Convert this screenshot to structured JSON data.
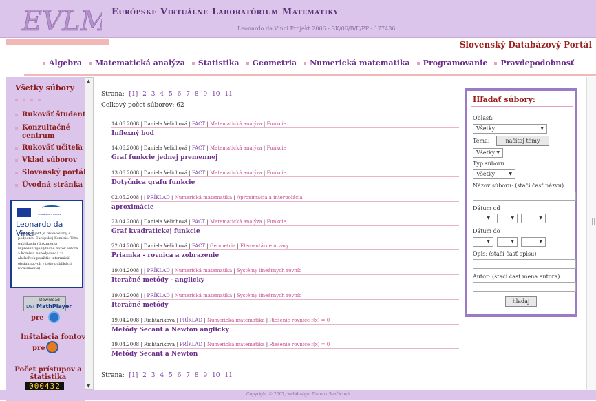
{
  "header": {
    "logo_text": "EVLM",
    "title": "Európske Virtuálne Laboratórium Matematiky",
    "subtitle": "Leonardo da Vinci Projekt 2006 - SK/06/B/F/PP - 177436",
    "portal_name": "Slovenský Databázový Portál"
  },
  "nav": {
    "items": [
      "Algebra",
      "Matematická analýza",
      "Štatistika",
      "Geometria",
      "Numerická matematika",
      "Programovanie",
      "Pravdepodobnosť"
    ]
  },
  "sidebar": {
    "title": "Všetky súbory",
    "items": [
      "Rukoväť študenta",
      "Konzultačné centrum",
      "Rukoväť učiteľa",
      "Vklad súborov",
      "Slovenský portál",
      "Úvodná stránka"
    ],
    "leonardo": {
      "small_text": "Vzdelávanie a kultúra",
      "name": "Leonardo da Vinci",
      "text": "Tento projekt je financovaný s podporou Európskej Komisie. Táto publikácia (dokument) reprezentuje výlučne názor autora a Komisia nezodpovedá za akékoľvek použitie informácií obsiahnutých v tejto publikácii (dokumente)."
    },
    "download_label": "Download",
    "mathplayer_label": "MathPlayer",
    "dsi_label": "DSI",
    "pre_label": "pre",
    "fonts_title": "Inštalácia fontov",
    "counter_title": "Počet prístupov a štatistika",
    "counter_value": "000432"
  },
  "content": {
    "pager_label": "Strana:",
    "pages": [
      "[1]",
      "2",
      "3",
      "4",
      "5",
      "6",
      "7",
      "8",
      "9",
      "10",
      "11"
    ],
    "total_label": "Celkový počet súborov: 62",
    "entries": [
      {
        "date": "14.06.2008",
        "author": "Daniela Velichová",
        "type": "FACT",
        "area": "Matematická analýza",
        "topic": "Funkcie",
        "name": "Inflexný bod"
      },
      {
        "date": "14.06.2008",
        "author": "Daniela Velichová",
        "type": "FACT",
        "area": "Matematická analýza",
        "topic": "Funkcie",
        "name": "Graf funkcie jednej premennej"
      },
      {
        "date": "13.06.2008",
        "author": "Daniela Velichová",
        "type": "FACT",
        "area": "Matematická analýza",
        "topic": "Funkcie",
        "name": "Dotyčnica grafu funkcie"
      },
      {
        "date": "02.05.2008",
        "author": "",
        "type": "PRÍKLAD",
        "area": "Numerická matematika",
        "topic": "Aproximácia a interpolácia",
        "name": "aproximácie"
      },
      {
        "date": "23.04.2008",
        "author": "Daniela Velichová",
        "type": "FACT",
        "area": "Matematická analýza",
        "topic": "Funkcie",
        "name": "Graf kvadratickej funkcie"
      },
      {
        "date": "22.04.2008",
        "author": "Daniela Velichová",
        "type": "FACT",
        "area": "Geometria",
        "topic": "Elementárne útvary",
        "name": "Priamka - rovnica a zobrazenie"
      },
      {
        "date": "19.04.2008",
        "author": "",
        "type": "PRÍKLAD",
        "area": "Numerická matematika",
        "topic": "Systémy lineárnych rovníc",
        "name": "Iteračné metódy - anglicky"
      },
      {
        "date": "19.04.2008",
        "author": "",
        "type": "PRÍKLAD",
        "area": "Numerická matematika",
        "topic": "Systémy lineárnych rovníc",
        "name": "Iteračné metódy"
      },
      {
        "date": "19.04.2008",
        "author": "Richtárikova",
        "type": "PRÍKLAD",
        "area": "Numerická matematika",
        "topic": "Riešenie rovnice f(x) = 0",
        "name": "Metódy Secant a Newton anglicky"
      },
      {
        "date": "19.04.2008",
        "author": "Richtárikova",
        "type": "PRÍKLAD",
        "area": "Numerická matematika",
        "topic": "Riešenie rovnice f(x) = 0",
        "name": "Metódy Secant a Newton"
      }
    ]
  },
  "search": {
    "title": "Hľadať súbory:",
    "area_label": "Oblasť:",
    "area_value": "Všetky",
    "topic_label": "Téma:",
    "load_button": "načítaj témy",
    "topic_value": "Všetky",
    "type_label": "Typ súboru",
    "type_value": "Všetky",
    "filename_label": "Názov súboru: (stačí časť názvu)",
    "date_from_label": "Dátum od",
    "date_to_label": "Dátum do",
    "description_label": "Opis: (stačí časť opisu)",
    "author_label": "Autor: (stačí časť mena autora)",
    "search_button": "hľadaj"
  },
  "footer": {
    "text": "Copyright © 2007, webdesign: Daroux Svačicová"
  }
}
